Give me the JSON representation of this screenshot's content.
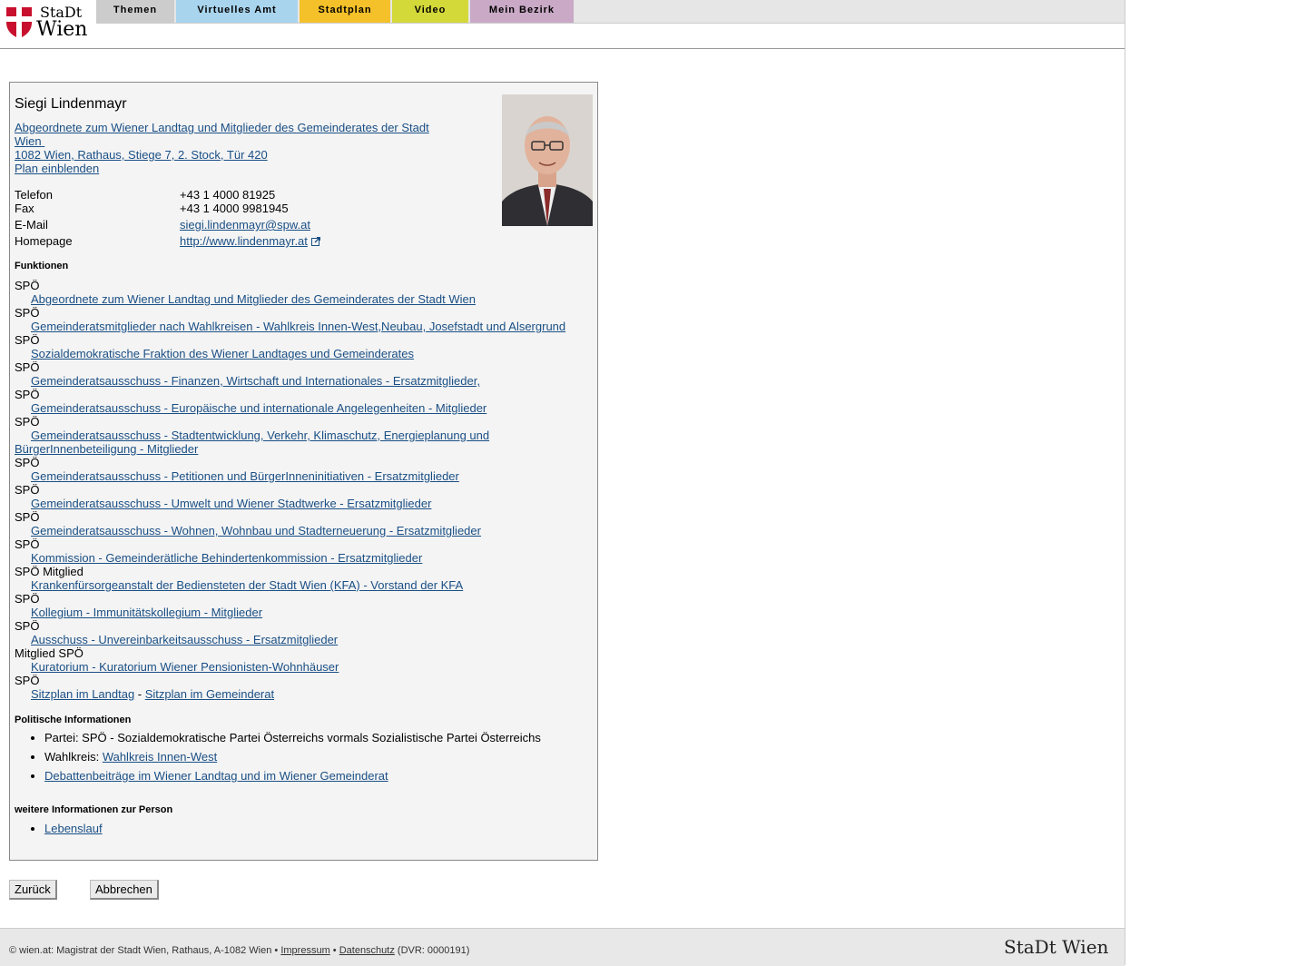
{
  "header": {
    "logo_top": "StaDt",
    "logo_bottom": "Wien",
    "nav": [
      {
        "label": "Themen",
        "color": "#cccccc"
      },
      {
        "label": "Virtuelles Amt",
        "color": "#a9d4ee"
      },
      {
        "label": "Stadtplan",
        "color": "#f4c12a"
      },
      {
        "label": "Video",
        "color": "#d4d93a"
      },
      {
        "label": "Mein Bezirk",
        "color": "#c9a9c6"
      }
    ]
  },
  "person": {
    "name": "Siegi Lindenmayr",
    "role_link": "Abgeordnete zum Wiener Landtag und Mitglieder des Gemeinderates der Stadt Wien",
    "role_line1": "Abgeordnete zum Wiener Landtag und Mitglieder des Gemeinderates der Stadt",
    "role_line2": "Wien",
    "address": "1082 Wien, Rathaus, Stiege 7, 2. Stock, Tür 420",
    "map_link": "Plan einblenden",
    "contact": {
      "phone_label": "Telefon",
      "phone": "+43 1 4000 81925",
      "fax_label": "Fax",
      "fax": "+43 1 4000 9981945",
      "email_label": "E-Mail",
      "email": "siegi.lindenmayr@spw.at",
      "homepage_label": "Homepage",
      "homepage": "http://www.lindenmayr.at"
    }
  },
  "functions": {
    "heading": "Funktionen",
    "items": [
      {
        "party": "SPÖ",
        "link": "Abgeordnete zum Wiener Landtag und Mitglieder des Gemeinderates der Stadt Wien"
      },
      {
        "party": "SPÖ",
        "link": "Gemeinderatsmitglieder nach Wahlkreisen - Wahlkreis Innen-West,Neubau, Josefstadt und Alsergrund"
      },
      {
        "party": "SPÖ",
        "link": "Sozialdemokratische Fraktion des Wiener Landtages und Gemeinderates"
      },
      {
        "party": "SPÖ",
        "link": "Gemeinderatsausschuss - Finanzen, Wirtschaft und Internationales - Ersatzmitglieder, "
      },
      {
        "party": "SPÖ",
        "link": "Gemeinderatsausschuss - Europäische und internationale Angelegenheiten - Mitglieder"
      },
      {
        "party": "SPÖ",
        "link": "Gemeinderatsausschuss - Stadtentwicklung, Verkehr, Klimaschutz, Energieplanung und BürgerInnenbeteiligung - Mitglieder"
      },
      {
        "party": "SPÖ",
        "link": "Gemeinderatsausschuss - Petitionen und BürgerInneninitiativen - Ersatzmitglieder"
      },
      {
        "party": "SPÖ",
        "link": "Gemeinderatsausschuss - Umwelt und Wiener Stadtwerke - Ersatzmitglieder"
      },
      {
        "party": "SPÖ",
        "link": "Gemeinderatsausschuss - Wohnen, Wohnbau und Stadterneuerung - Ersatzmitglieder"
      },
      {
        "party": "SPÖ",
        "link": "Kommission - Gemeinderätliche Behindertenkommission - Ersatzmitglieder"
      },
      {
        "party": "SPÖ Mitglied",
        "link": "Krankenfürsorgeanstalt der Bediensteten der Stadt Wien (KFA) - Vorstand der KFA"
      },
      {
        "party": "SPÖ",
        "link": "Kollegium - Immunitätskollegium - Mitglieder"
      },
      {
        "party": "SPÖ",
        "link": "Ausschuss - Unvereinbarkeitsausschuss - Ersatzmitglieder"
      },
      {
        "party": "Mitglied SPÖ",
        "link": "Kuratorium - Kuratorium Wiener Pensionisten-Wohnhäuser"
      }
    ],
    "last_party": "SPÖ",
    "seat_landtag": "Sitzplan im Landtag",
    "seat_sep": " - ",
    "seat_gemeinderat": "Sitzplan im Gemeinderat"
  },
  "political": {
    "heading": "Politische Informationen",
    "party_text": "Partei: SPÖ - Sozialdemokratische Partei Österreichs vormals Sozialistische Partei Österreichs",
    "district_label": "Wahlkreis: ",
    "district_link": "Wahlkreis Innen-West",
    "debate_link": "Debattenbeiträge im Wiener Landtag und im Wiener Gemeinderat"
  },
  "more": {
    "heading": "weitere Informationen zur Person",
    "cv_link": "Lebenslauf"
  },
  "buttons": {
    "back": "Zurück",
    "cancel": "Abbrechen"
  },
  "footer": {
    "copyright": "© wien.at: Magistrat der Stadt Wien, Rathaus, A-1082 Wien • ",
    "impressum": "Impressum",
    "bullet": " • ",
    "datenschutz": "Datenschutz",
    "dvr": " (DVR: 0000191)",
    "logo": "StaDt Wien"
  }
}
